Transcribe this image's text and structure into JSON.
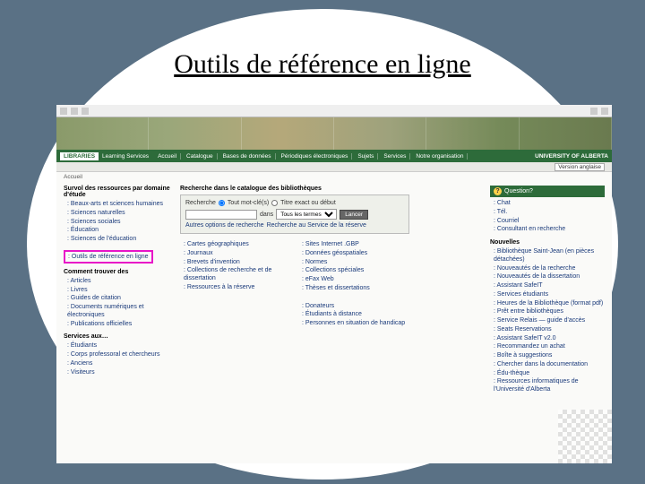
{
  "slide": {
    "title": "Outils de référence en ligne"
  },
  "browser": {
    "title_bar": "..."
  },
  "nav": {
    "libs": "LIBRARIES",
    "learning": "Learning Services",
    "items": [
      "Accueil",
      "Catalogue",
      "Bases de données",
      "Périodiques électroniques",
      "Sujets",
      "Services",
      "Notre organisation"
    ],
    "university": "UNIVERSITY OF ALBERTA"
  },
  "subbar": {
    "lang": "Version anglaise"
  },
  "crumb": "Accueil",
  "left": {
    "sect1_title": "Survol des ressources par domaine d'étude",
    "sect1_items": [
      "Beaux-arts et sciences humaines",
      "Sciences naturelles",
      "Sciences sociales",
      "Éducation",
      "Sciences de l'éducation"
    ],
    "highlight": "Outils de référence en ligne",
    "sect2_title": "Comment trouver des",
    "sect2_items": [
      "Articles",
      "Livres",
      "Guides de citation",
      "Documents numériques et électroniques",
      "Publications officielles"
    ],
    "sect3_title": "Services aux…",
    "sect3_items": [
      "Étudiants",
      "Corps professoral et chercheurs",
      "Anciens",
      "Visiteurs"
    ]
  },
  "search": {
    "title": "Recherche dans le catalogue des bibliothèques",
    "label": "Recherche",
    "radio1": "Tout mot-clé(s)",
    "radio2": "Titre exact ou début",
    "in": "dans",
    "select": "Tous les termes",
    "go": "Lancer",
    "other": "Autres options de recherche",
    "reserve": "Recherche au Service de la réserve"
  },
  "mid": {
    "colA": [
      "Cartes géographiques",
      "Journaux",
      "Brevets d'invention",
      "Collections de recherche et de dissertation",
      "Ressources à la réserve"
    ],
    "colB": [
      "Sites Internet .GBP",
      "Données géospatiales",
      "Normes",
      "Collections spéciales",
      "eFax Web",
      "Thèses et dissertations"
    ],
    "svc_colA": [
      "Donateurs",
      "Étudiants à distance",
      "Personnes en situation de handicap"
    ]
  },
  "right": {
    "question": "Question?",
    "q_items": [
      "Chat",
      "Tél.",
      "Courriel",
      "Consultant en recherche"
    ],
    "news_title": "Nouvelles",
    "news_items": [
      "Bibliothèque Saint-Jean (en pièces détachées)",
      "Nouveautés de la recherche",
      "Nouveautés de la dissertation",
      "Assistant SafeIT",
      "Services étudiants",
      "Heures de la Bibliothèque (format pdf)",
      "Prêt entre bibliothèques",
      "Service Relais — guide d'accès",
      "Seats Reservations",
      "Assistant SafeIT v2.0",
      "Recommandez un achat",
      "Boîte à suggestions",
      "Chercher dans la documentation",
      "Édu-thèque",
      "Ressources informatiques de l'Université d'Alberta"
    ]
  }
}
